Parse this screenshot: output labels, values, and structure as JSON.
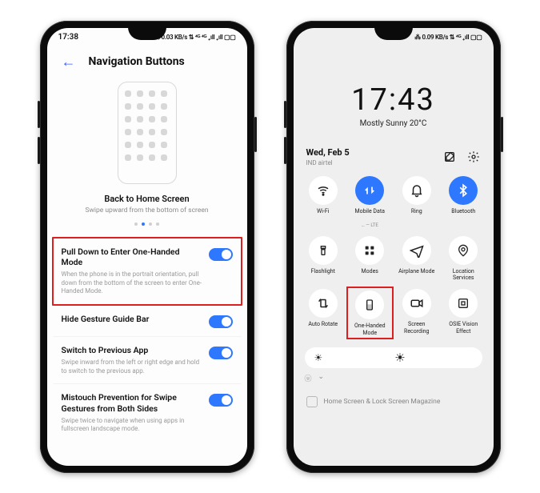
{
  "left": {
    "status_time": "17:38",
    "status_right": "⁂ 0.03 KB/s ⇅ ⁴ᴳ ⁴ᴳ ₊ıll ₊ıll ▢▢",
    "header_title": "Navigation Buttons",
    "preview_title": "Back to Home Screen",
    "preview_subtitle": "Swipe upward from the bottom of screen",
    "settings": [
      {
        "title": "Pull Down to Enter One-Handed Mode",
        "desc": "When the phone is in the portrait orientation, pull down from the bottom of the screen to enter One-Handed Mode."
      },
      {
        "title": "Hide Gesture Guide Bar",
        "desc": ""
      },
      {
        "title": "Switch to Previous App",
        "desc": "Swipe inward from the left or right edge and hold to switch to the previous app."
      },
      {
        "title": "Mistouch Prevention for Swipe Gestures from Both Sides",
        "desc": "Swipe twice to navigate when using apps in fullscreen landscape mode."
      }
    ]
  },
  "right": {
    "status_right": "⁂ 0.09 KB/s ⇅ ⁴ᴳ ₊ıll ▢▢",
    "time": "17:43",
    "weather": "Mostly Sunny 20°C",
    "date": "Wed, Feb 5",
    "carrier": "IND airtel",
    "tiles": [
      {
        "label": "Wi-Fi",
        "icon": "wifi",
        "active": false,
        "sub": ""
      },
      {
        "label": "Mobile Data",
        "icon": "data",
        "active": true,
        "sub": "… — LTE"
      },
      {
        "label": "Ring",
        "icon": "bell",
        "active": false,
        "sub": ""
      },
      {
        "label": "Bluetooth",
        "icon": "bt",
        "active": true,
        "sub": ""
      },
      {
        "label": "Flashlight",
        "icon": "flash",
        "active": false,
        "sub": ""
      },
      {
        "label": "Modes",
        "icon": "modes",
        "active": false,
        "sub": ""
      },
      {
        "label": "Airplane Mode",
        "icon": "plane",
        "active": false,
        "sub": ""
      },
      {
        "label": "Location Services",
        "icon": "location",
        "active": false,
        "sub": ""
      },
      {
        "label": "Auto Rotate",
        "icon": "rotate",
        "active": false,
        "sub": ""
      },
      {
        "label": "One-Handed Mode",
        "icon": "onehand",
        "active": false,
        "sub": ""
      },
      {
        "label": "Screen Recording",
        "icon": "record",
        "active": false,
        "sub": ""
      },
      {
        "label": "OSIE Vision Effect",
        "icon": "osie",
        "active": false,
        "sub": ""
      }
    ],
    "bg_item": "Home Screen & Lock Screen Magazine"
  }
}
